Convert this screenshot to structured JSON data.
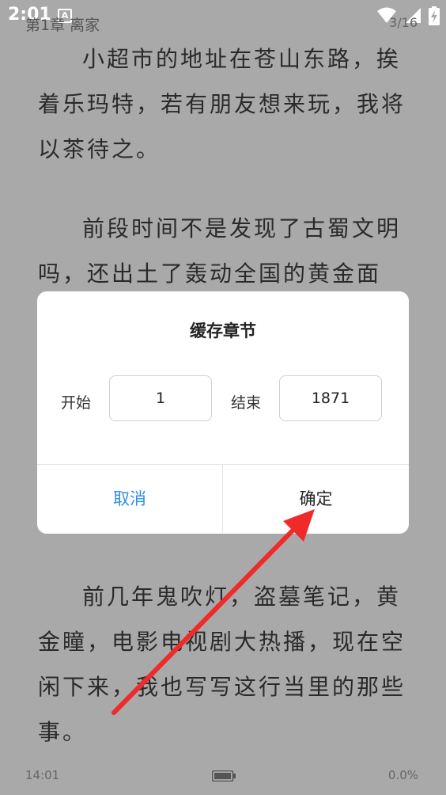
{
  "status_bar": {
    "time": "2:01",
    "a_icon": "A"
  },
  "reader": {
    "chapter_title": "第1章 离家",
    "page_counter": "3/16",
    "paragraph_1": "小超市的地址在苍山东路，挨着乐玛特，若有朋友想来玩，我将以茶待之。",
    "paragraph_2": "前段时间不是发现了古蜀文明吗，还出土了轰动全国的黄金面",
    "paragraph_3": "前几年鬼吹灯，盗墓笔记，黄金瞳，电影电视剧大热播，现在空闲下来，我也写写这行当里的那些事。",
    "footer_time": "14:01",
    "footer_progress": "0.0%"
  },
  "dialog": {
    "title": "缓存章节",
    "start_label": "开始",
    "start_value": "1",
    "end_label": "结束",
    "end_value": "1871",
    "cancel_label": "取消",
    "ok_label": "确定"
  },
  "colors": {
    "overlay_bg": "#a9a9a9",
    "cancel": "#2d8fe5",
    "arrow": "#ee2a2a"
  }
}
